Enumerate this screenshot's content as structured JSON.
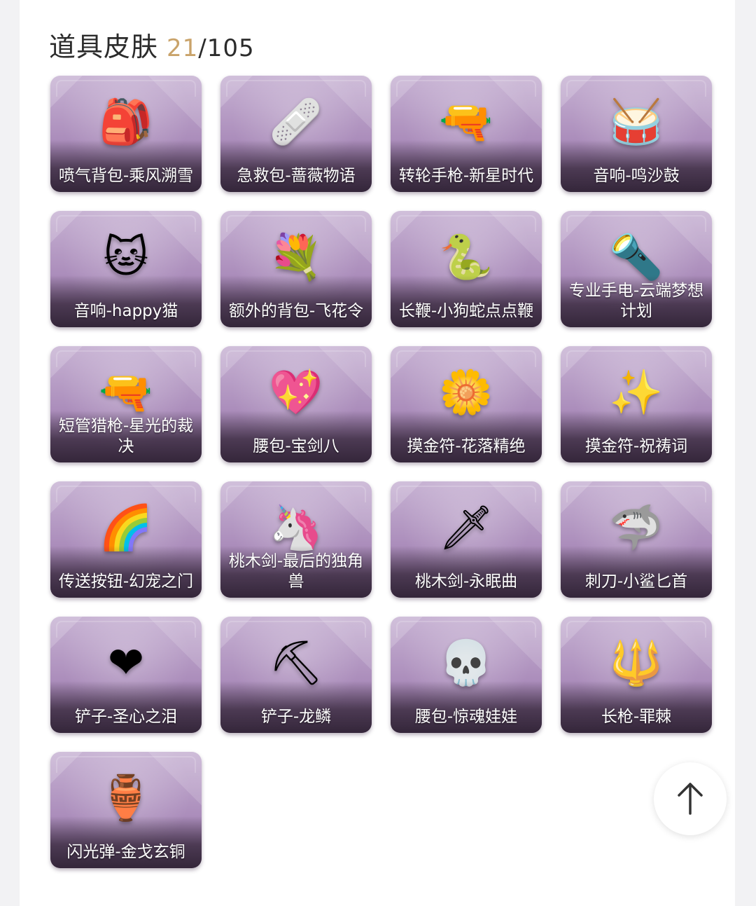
{
  "header": {
    "title": "道具皮肤",
    "owned": "21",
    "separator": "/",
    "total": "105"
  },
  "colors": {
    "accent_count": "#c9a36a",
    "card_purple": "#ab8dbb"
  },
  "items": [
    {
      "label": "喷气背包-乘风溯雪",
      "icon": "jetpack-icon",
      "glyph": "🎒"
    },
    {
      "label": "急救包-蔷薇物语",
      "icon": "first-aid-kit-icon",
      "glyph": "🩹"
    },
    {
      "label": "转轮手枪-新星时代",
      "icon": "revolver-icon",
      "glyph": "🔫"
    },
    {
      "label": "音响-鸣沙鼓",
      "icon": "drum-speaker-icon",
      "glyph": "🥁"
    },
    {
      "label": "音响-happy猫",
      "icon": "cat-speaker-icon",
      "glyph": "🐱"
    },
    {
      "label": "额外的背包-飞花令",
      "icon": "flower-backpack-icon",
      "glyph": "💐"
    },
    {
      "label": "长鞭-小狗蛇点点鞭",
      "icon": "snake-whip-icon",
      "glyph": "🐍"
    },
    {
      "label": "专业手电-云端梦想计划",
      "icon": "flashlight-icon",
      "glyph": "🔦"
    },
    {
      "label": "短管猎枪-星光的裁决",
      "icon": "shotgun-icon",
      "glyph": "🔫"
    },
    {
      "label": "腰包-宝剑八",
      "icon": "heart-pouch-icon",
      "glyph": "💖"
    },
    {
      "label": "摸金符-花落精绝",
      "icon": "gold-flower-charm-icon",
      "glyph": "🌼"
    },
    {
      "label": "摸金符-祝祷词",
      "icon": "gold-knot-charm-icon",
      "glyph": "✨"
    },
    {
      "label": "传送按钮-幻宠之门",
      "icon": "rainbow-portal-icon",
      "glyph": "🌈"
    },
    {
      "label": "桃木剑-最后的独角兽",
      "icon": "unicorn-horn-sword-icon",
      "glyph": "🦄"
    },
    {
      "label": "桃木剑-永眠曲",
      "icon": "purple-sword-icon",
      "glyph": "🗡"
    },
    {
      "label": "刺刀-小鲨匕首",
      "icon": "shark-dagger-icon",
      "glyph": "🦈"
    },
    {
      "label": "铲子-圣心之泪",
      "icon": "heart-shovel-icon",
      "glyph": "❤"
    },
    {
      "label": "铲子-龙鳞",
      "icon": "golden-shovel-icon",
      "glyph": "⛏"
    },
    {
      "label": "腰包-惊魂娃娃",
      "icon": "skull-doll-pouch-icon",
      "glyph": "💀"
    },
    {
      "label": "长枪-罪棘",
      "icon": "spear-icon",
      "glyph": "🔱"
    },
    {
      "label": "闪光弹-金戈玄铜",
      "icon": "bronze-grenade-icon",
      "glyph": "🏺"
    }
  ],
  "scroll_top": {
    "icon": "arrow-up-icon"
  }
}
